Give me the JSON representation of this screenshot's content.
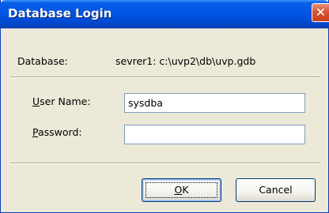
{
  "window": {
    "title": "Database Login",
    "close_glyph": "✕"
  },
  "info": {
    "database_label": "Database:",
    "database_value": "sevrer1: c:\\uvp2\\db\\uvp.gdb"
  },
  "form": {
    "username": {
      "label_mnemonic": "U",
      "label_rest": "ser Name:",
      "value": "sysdba"
    },
    "password": {
      "label_mnemonic": "P",
      "label_rest": "assword:",
      "value": ""
    }
  },
  "buttons": {
    "ok": {
      "label_mnemonic": "O",
      "label_rest": "K"
    },
    "cancel": {
      "label": "Cancel"
    }
  },
  "colors": {
    "titlebar": "#0055e5",
    "close_button": "#d9532f",
    "dialog_background": "#ece9d8",
    "input_border": "#7f9db9",
    "button_border": "#003c74"
  },
  "icons": {
    "close": "close-icon"
  }
}
